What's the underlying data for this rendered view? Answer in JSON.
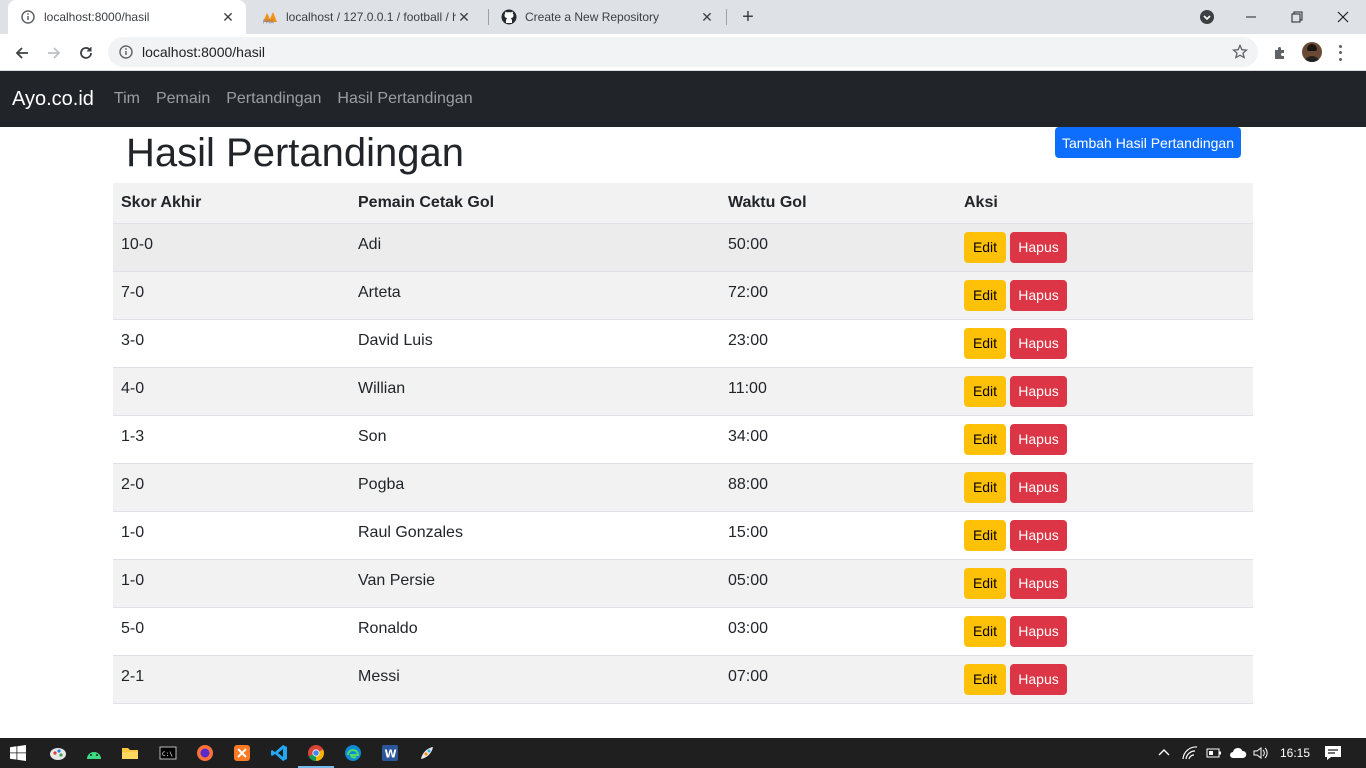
{
  "browser": {
    "tabs": [
      {
        "title": "localhost:8000/hasil",
        "active": true
      },
      {
        "title": "localhost / 127.0.0.1 / football / h",
        "active": false
      },
      {
        "title": "Create a New Repository",
        "active": false
      }
    ],
    "url": "localhost:8000/hasil"
  },
  "navbar": {
    "brand": "Ayo.co.id",
    "links": [
      "Tim",
      "Pemain",
      "Pertandingan",
      "Hasil Pertandingan"
    ]
  },
  "page": {
    "title": "Hasil Pertandingan",
    "add_button": "Tambah Hasil Pertandingan"
  },
  "table": {
    "headers": [
      "Skor Akhir",
      "Pemain Cetak Gol",
      "Waktu Gol",
      "Aksi"
    ],
    "edit_label": "Edit",
    "delete_label": "Hapus",
    "rows": [
      {
        "skor": "10-0",
        "pemain": "Adi",
        "waktu": "50:00"
      },
      {
        "skor": "7-0",
        "pemain": "Arteta",
        "waktu": "72:00"
      },
      {
        "skor": "3-0",
        "pemain": "David Luis",
        "waktu": "23:00"
      },
      {
        "skor": "4-0",
        "pemain": "Willian",
        "waktu": "11:00"
      },
      {
        "skor": "1-3",
        "pemain": "Son",
        "waktu": "34:00"
      },
      {
        "skor": "2-0",
        "pemain": "Pogba",
        "waktu": "88:00"
      },
      {
        "skor": "1-0",
        "pemain": "Raul Gonzales",
        "waktu": "15:00"
      },
      {
        "skor": "1-0",
        "pemain": "Van Persie",
        "waktu": "05:00"
      },
      {
        "skor": "5-0",
        "pemain": "Ronaldo",
        "waktu": "03:00"
      },
      {
        "skor": "2-1",
        "pemain": "Messi",
        "waktu": "07:00"
      }
    ]
  },
  "taskbar": {
    "clock": "16:15"
  },
  "colors": {
    "navbar_bg": "#212529",
    "primary": "#0d6efd",
    "warning": "#ffc107",
    "danger": "#dc3545"
  }
}
